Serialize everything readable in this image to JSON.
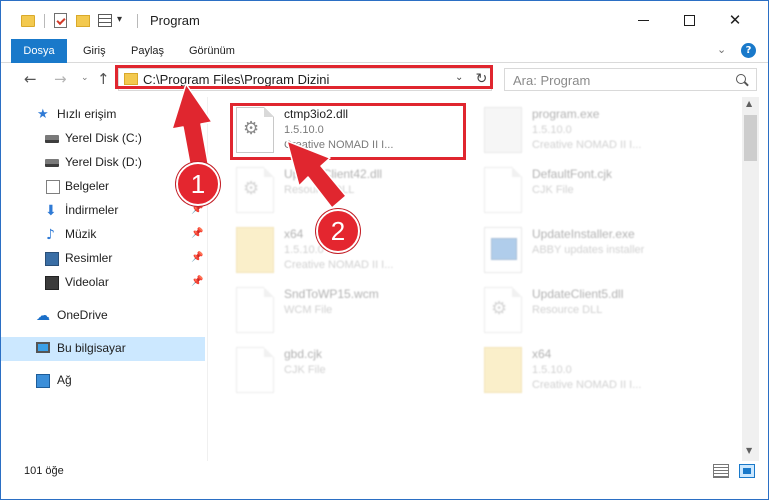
{
  "window": {
    "title": "Program",
    "controls": {
      "minimize": "minimize",
      "maximize": "maximize",
      "close": "✕"
    }
  },
  "ribbon": {
    "tabs": [
      {
        "label": "Dosya",
        "active": true
      },
      {
        "label": "Giriş"
      },
      {
        "label": "Paylaş"
      },
      {
        "label": "Görünüm"
      }
    ],
    "help": "?"
  },
  "navigation": {
    "address": "C:\\Program Files\\Program Dizini",
    "search_placeholder": "Ara: Program"
  },
  "sidebar": {
    "items": [
      {
        "label": "Hızlı erişim",
        "icon": "star-icon"
      },
      {
        "label": "Yerel Disk (C:)",
        "icon": "disk-icon",
        "pinned": true
      },
      {
        "label": "Yerel Disk (D:)",
        "icon": "disk-icon",
        "pinned": true
      },
      {
        "label": "Belgeler",
        "icon": "documents-icon",
        "pinned": true
      },
      {
        "label": "İndirmeler",
        "icon": "downloads-icon",
        "pinned": true
      },
      {
        "label": "Müzik",
        "icon": "music-icon",
        "pinned": true
      },
      {
        "label": "Resimler",
        "icon": "pictures-icon",
        "pinned": true
      },
      {
        "label": "Videolar",
        "icon": "videos-icon",
        "pinned": true
      },
      {
        "label": "OneDrive",
        "icon": "cloud-icon"
      },
      {
        "label": "Bu bilgisayar",
        "icon": "computer-icon",
        "selected": true
      },
      {
        "label": "Ağ",
        "icon": "network-icon"
      }
    ]
  },
  "files": [
    {
      "name": "ctmp3io2.dll",
      "line2": "1.5.10.0",
      "line3": "Creative NOMAD II I...",
      "icon": "dll-gear-icon",
      "highlighted": true
    },
    {
      "name": "program.exe",
      "line2": "1.5.10.0",
      "line3": "Creative NOMAD II I...",
      "icon": "exe-icon"
    },
    {
      "name": "UpdateClient42.dll",
      "line2": "Resource DLL",
      "line3": "",
      "icon": "dll-gear-icon"
    },
    {
      "name": "DefaultFont.cjk",
      "line2": "CJK File",
      "line3": "",
      "icon": "file-icon"
    },
    {
      "name": "x64",
      "line2": "1.5.10.0",
      "line3": "Creative NOMAD II I...",
      "icon": "folder-icon"
    },
    {
      "name": "UpdateInstaller.exe",
      "line2": "ABBY updates installer",
      "line3": "",
      "icon": "installer-icon"
    },
    {
      "name": "SndToWP15.wcm",
      "line2": "WCM File",
      "line3": "",
      "icon": "file-icon"
    },
    {
      "name": "UpdateClient5.dll",
      "line2": "Resource DLL",
      "line3": "",
      "icon": "dll-gear-icon"
    },
    {
      "name": "gbd.cjk",
      "line2": "CJK File",
      "line3": "",
      "icon": "file-icon"
    },
    {
      "name": "x64",
      "line2": "1.5.10.0",
      "line3": "Creative NOMAD II I...",
      "icon": "folder-icon"
    }
  ],
  "status": {
    "count": "101 öğe"
  },
  "annotations": {
    "step1": "1",
    "step2": "2",
    "color": "#e0262f"
  }
}
